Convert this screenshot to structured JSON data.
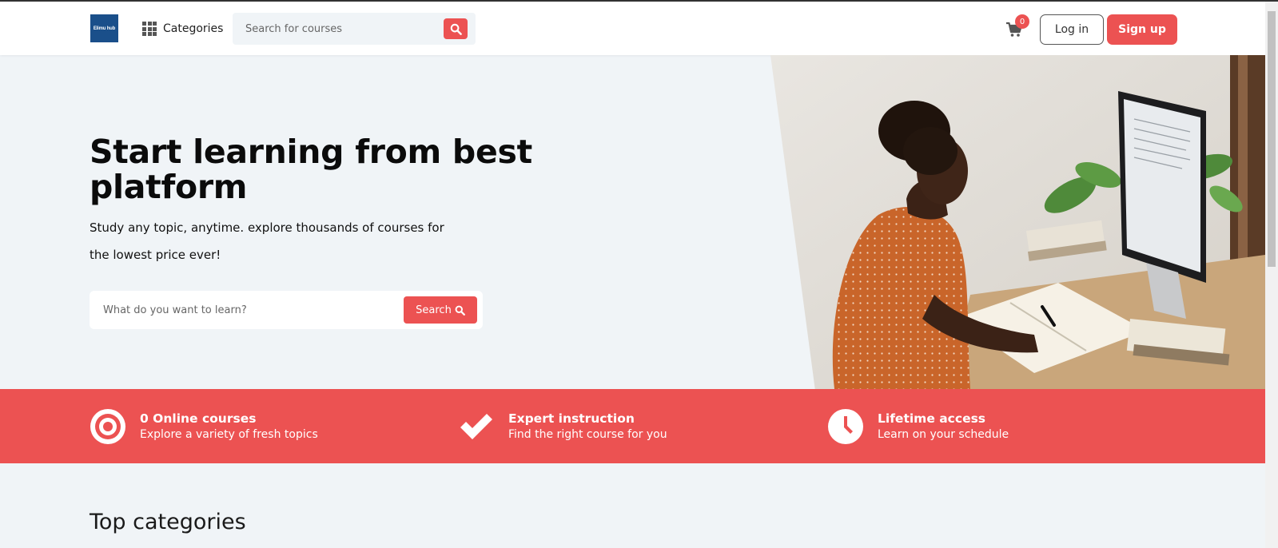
{
  "header": {
    "logo_text": "Elimu hub",
    "categories_label": "Categories",
    "search_placeholder": "Search for courses",
    "cart_count": "0",
    "login_label": "Log in",
    "signup_label": "Sign up"
  },
  "hero": {
    "title": "Start learning from best platform",
    "subtitle": "Study any topic, anytime. explore thousands of courses for the lowest price ever!",
    "search_placeholder": "What do you want to learn?",
    "search_button": "Search"
  },
  "features": [
    {
      "icon": "target-icon",
      "title": "0 Online courses",
      "desc": "Explore a variety of fresh topics"
    },
    {
      "icon": "check-icon",
      "title": "Expert instruction",
      "desc": "Find the right course for you"
    },
    {
      "icon": "clock-icon",
      "title": "Lifetime access",
      "desc": "Learn on your schedule"
    }
  ],
  "sections": {
    "top_categories_title": "Top categories"
  },
  "colors": {
    "accent": "#ec5252",
    "background": "#f0f4f7",
    "header_bg": "#ffffff"
  }
}
